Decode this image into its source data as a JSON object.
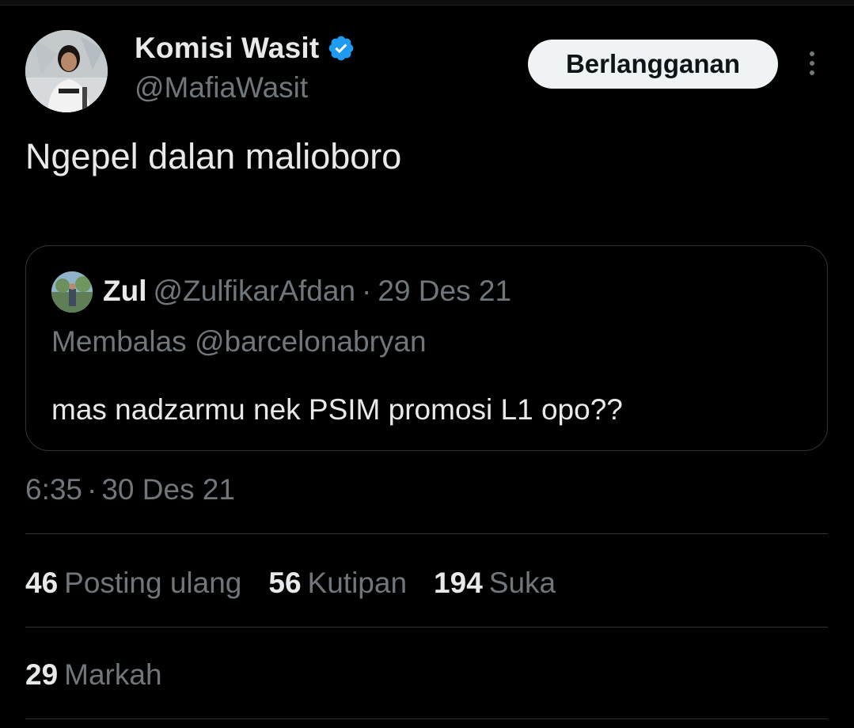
{
  "author": {
    "display_name": "Komisi Wasit",
    "handle": "@MafiaWasit",
    "verified": true,
    "avatar_icon": "profile-photo"
  },
  "subscribe_label": "Berlangganan",
  "tweet_text": "Ngepel dalan malioboro",
  "quoted": {
    "name": "Zul",
    "handle": "@ZulfikarAfdan",
    "separator": "·",
    "date": "29 Des 21",
    "reply_to": "Membalas @barcelonabryan",
    "text": "mas nadzarmu nek PSIM promosi L1 opo??"
  },
  "timestamp": {
    "time": "6:35",
    "separator": "·",
    "date": "30 Des 21"
  },
  "stats": [
    {
      "count": "46",
      "label": "Posting ulang"
    },
    {
      "count": "56",
      "label": "Kutipan"
    },
    {
      "count": "194",
      "label": "Suka"
    }
  ],
  "bookmarks": {
    "count": "29",
    "label": "Markah"
  },
  "colors": {
    "background": "#000000",
    "text_primary": "#e7e9ea",
    "text_secondary": "#71767b",
    "border": "#2f3336",
    "verified_blue": "#1d9bf0",
    "button_bg": "#eff3f4"
  }
}
